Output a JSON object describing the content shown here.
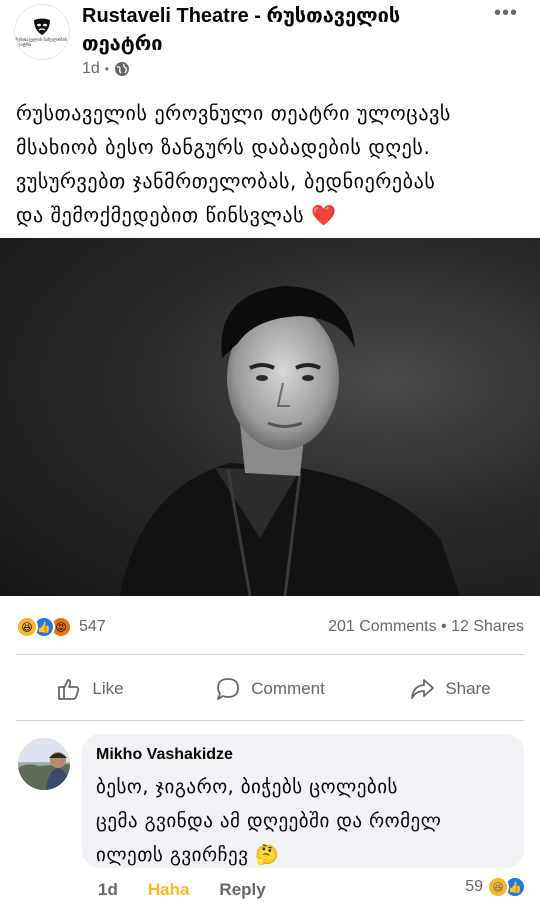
{
  "post": {
    "page_name": "Rustaveli Theatre - რუსთაველის თეატრი",
    "logo_text": "რუსთაველის სახელობის თეატრი",
    "time": "1d",
    "audience_icon": "globe-icon",
    "more_icon": "more-options-icon",
    "more_label": "•••",
    "text_lines": [
      "რუსთაველის ეროვნული თეატრი ულოცავს",
      "მსახიობ ბესო ზანგურს დაბადების დღეს.",
      "ვუსურვებთ ჯანმრთელობას, ბედნიერებას",
      "და შემოქმედებით წინსვლას"
    ],
    "heart": "❤️",
    "photo_icon": "portrait-photo"
  },
  "stats": {
    "reaction_icons": [
      "haha-reaction-icon",
      "like-reaction-icon",
      "angry-reaction-icon"
    ],
    "reaction_glyphs": [
      "😆",
      "👍",
      "😡"
    ],
    "reactions": "547",
    "comments_shares": "201 Comments • 12 Shares"
  },
  "actions": {
    "like": "Like",
    "comment": "Comment",
    "share": "Share"
  },
  "comment": {
    "author": "Mikho Vashakidze",
    "text_lines": [
      "ბესო, ჯიგარო, ბიჭებს ცოლების",
      "ცემა გვინდა ამ დღეებში და რომელ",
      "ილეთს გვირჩევ"
    ],
    "emoji": "🤔",
    "time": "1d",
    "reaction_label": "Haha",
    "reply": "Reply",
    "reaction_count": "59",
    "reaction_glyphs": [
      "😆",
      "👍"
    ]
  },
  "colors": {
    "accent": "#1877f2",
    "haha": "#f7b928",
    "heart": "#e41e3f",
    "muted": "#65676b"
  }
}
